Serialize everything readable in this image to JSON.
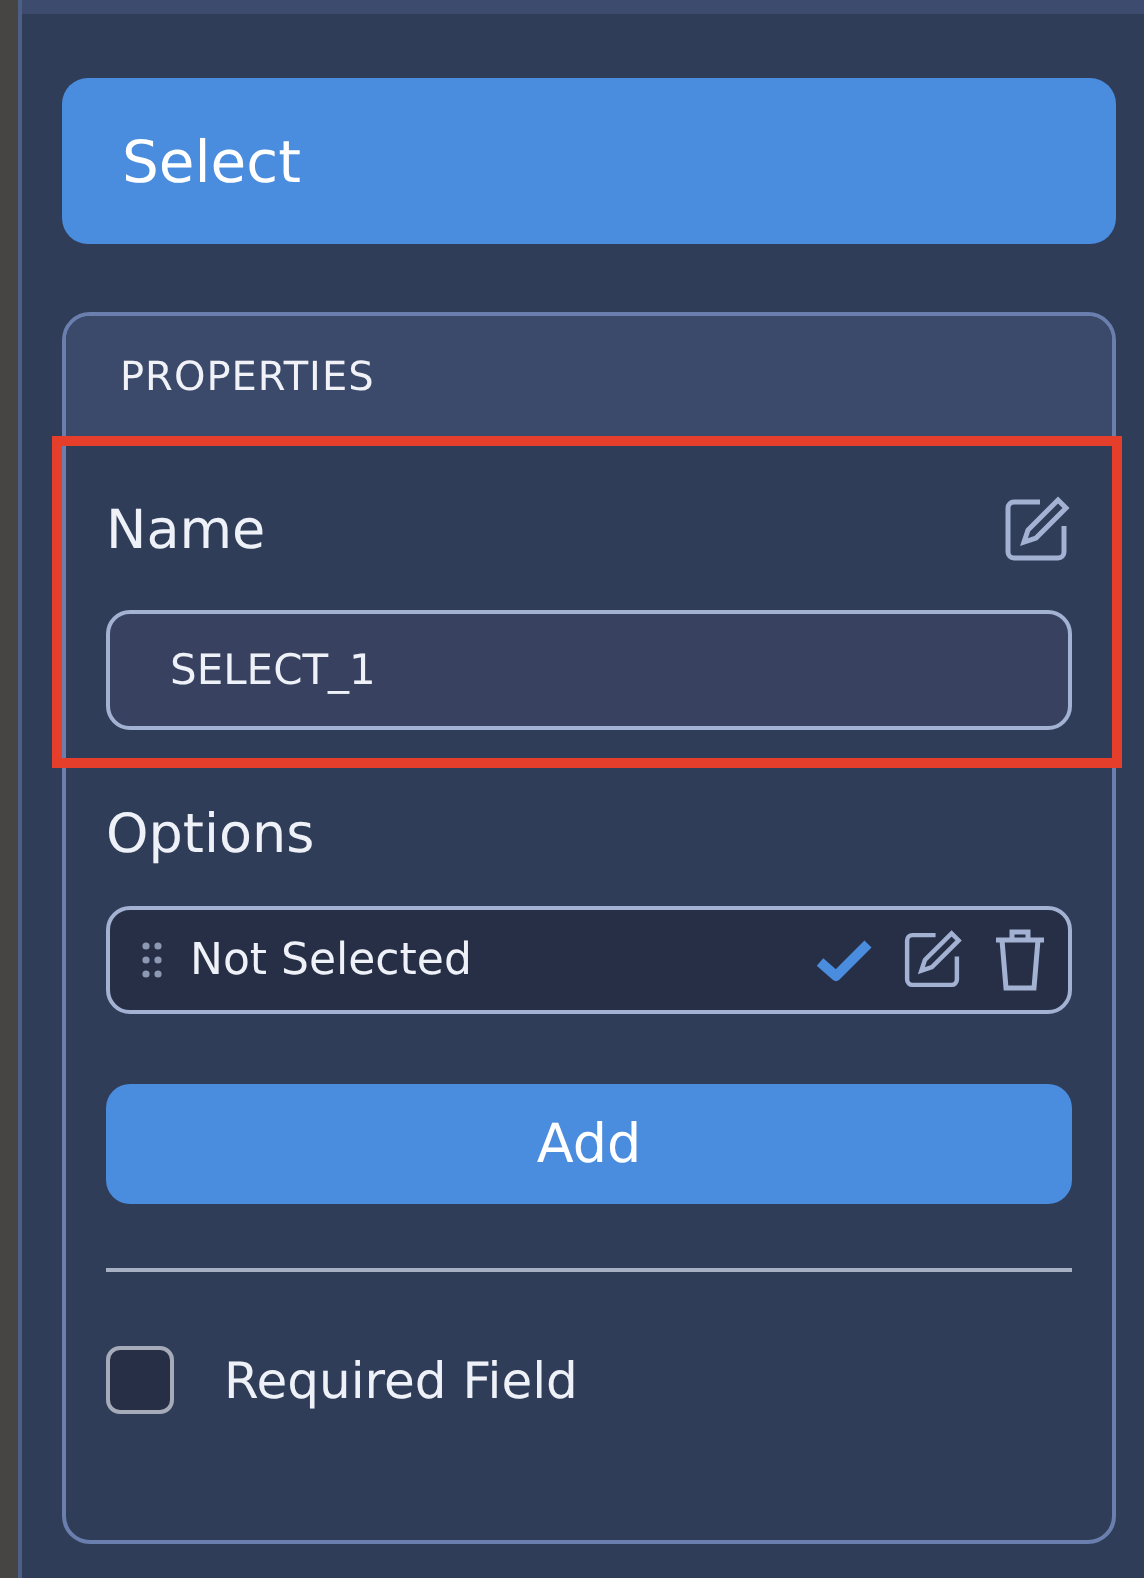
{
  "header": {
    "label": "Select"
  },
  "properties": {
    "title": "PROPERTIES",
    "name_field": {
      "label": "Name",
      "value": "SELECT_1",
      "highlighted": true
    },
    "options": {
      "label": "Options",
      "items": [
        {
          "label": "Not Selected",
          "checked": true
        }
      ]
    },
    "add_button": "Add",
    "required": {
      "label": "Required Field",
      "checked": false
    }
  }
}
